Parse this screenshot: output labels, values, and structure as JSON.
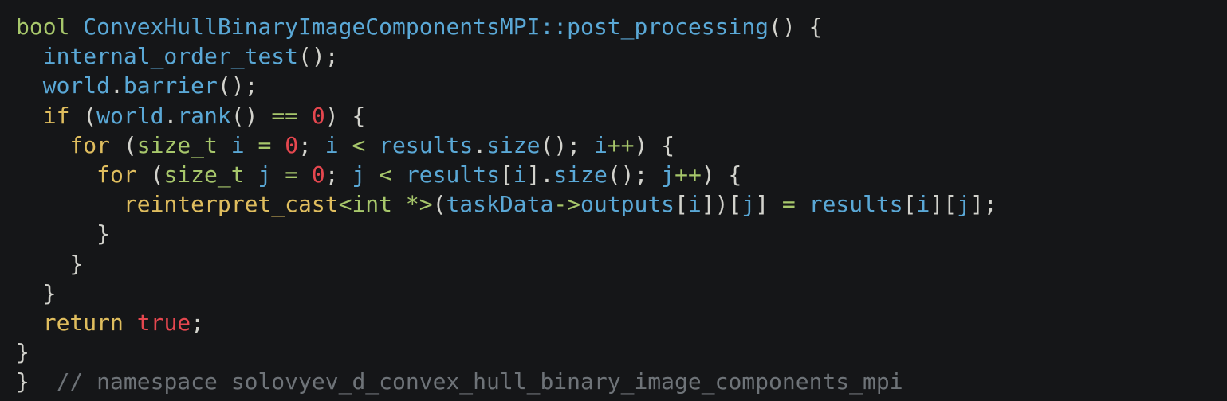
{
  "lines": [
    [
      {
        "t": "bool",
        "c": "type"
      },
      {
        "t": " ",
        "c": "plain"
      },
      {
        "t": "ConvexHullBinaryImageComponentsMPI",
        "c": "fn"
      },
      {
        "t": "::",
        "c": "fn"
      },
      {
        "t": "post_processing",
        "c": "fn"
      },
      {
        "t": "() {",
        "c": "plain"
      }
    ],
    [
      {
        "t": "  ",
        "c": "plain"
      },
      {
        "t": "internal_order_test",
        "c": "fn"
      },
      {
        "t": "();",
        "c": "plain"
      }
    ],
    [
      {
        "t": "  ",
        "c": "plain"
      },
      {
        "t": "world",
        "c": "fn"
      },
      {
        "t": ".",
        "c": "plain"
      },
      {
        "t": "barrier",
        "c": "fn"
      },
      {
        "t": "();",
        "c": "plain"
      }
    ],
    [
      {
        "t": "  ",
        "c": "plain"
      },
      {
        "t": "if",
        "c": "kw"
      },
      {
        "t": " (",
        "c": "plain"
      },
      {
        "t": "world",
        "c": "fn"
      },
      {
        "t": ".",
        "c": "plain"
      },
      {
        "t": "rank",
        "c": "fn"
      },
      {
        "t": "() ",
        "c": "plain"
      },
      {
        "t": "==",
        "c": "op"
      },
      {
        "t": " ",
        "c": "plain"
      },
      {
        "t": "0",
        "c": "num"
      },
      {
        "t": ") {",
        "c": "plain"
      }
    ],
    [
      {
        "t": "    ",
        "c": "plain"
      },
      {
        "t": "for",
        "c": "kw"
      },
      {
        "t": " (",
        "c": "plain"
      },
      {
        "t": "size_t",
        "c": "type"
      },
      {
        "t": " ",
        "c": "plain"
      },
      {
        "t": "i",
        "c": "fn"
      },
      {
        "t": " ",
        "c": "plain"
      },
      {
        "t": "=",
        "c": "op"
      },
      {
        "t": " ",
        "c": "plain"
      },
      {
        "t": "0",
        "c": "num"
      },
      {
        "t": "; ",
        "c": "plain"
      },
      {
        "t": "i",
        "c": "fn"
      },
      {
        "t": " ",
        "c": "plain"
      },
      {
        "t": "<",
        "c": "op"
      },
      {
        "t": " ",
        "c": "plain"
      },
      {
        "t": "results",
        "c": "fn"
      },
      {
        "t": ".",
        "c": "plain"
      },
      {
        "t": "size",
        "c": "fn"
      },
      {
        "t": "(); ",
        "c": "plain"
      },
      {
        "t": "i",
        "c": "fn"
      },
      {
        "t": "++",
        "c": "op"
      },
      {
        "t": ") {",
        "c": "plain"
      }
    ],
    [
      {
        "t": "      ",
        "c": "plain"
      },
      {
        "t": "for",
        "c": "kw"
      },
      {
        "t": " (",
        "c": "plain"
      },
      {
        "t": "size_t",
        "c": "type"
      },
      {
        "t": " ",
        "c": "plain"
      },
      {
        "t": "j",
        "c": "fn"
      },
      {
        "t": " ",
        "c": "plain"
      },
      {
        "t": "=",
        "c": "op"
      },
      {
        "t": " ",
        "c": "plain"
      },
      {
        "t": "0",
        "c": "num"
      },
      {
        "t": "; ",
        "c": "plain"
      },
      {
        "t": "j",
        "c": "fn"
      },
      {
        "t": " ",
        "c": "plain"
      },
      {
        "t": "<",
        "c": "op"
      },
      {
        "t": " ",
        "c": "plain"
      },
      {
        "t": "results",
        "c": "fn"
      },
      {
        "t": "[",
        "c": "plain"
      },
      {
        "t": "i",
        "c": "fn"
      },
      {
        "t": "].",
        "c": "plain"
      },
      {
        "t": "size",
        "c": "fn"
      },
      {
        "t": "(); ",
        "c": "plain"
      },
      {
        "t": "j",
        "c": "fn"
      },
      {
        "t": "++",
        "c": "op"
      },
      {
        "t": ") {",
        "c": "plain"
      }
    ],
    [
      {
        "t": "        ",
        "c": "plain"
      },
      {
        "t": "reinterpret_cast",
        "c": "kw"
      },
      {
        "t": "<",
        "c": "op"
      },
      {
        "t": "int",
        "c": "type"
      },
      {
        "t": " ",
        "c": "plain"
      },
      {
        "t": "*>",
        "c": "op"
      },
      {
        "t": "(",
        "c": "plain"
      },
      {
        "t": "taskData",
        "c": "fn"
      },
      {
        "t": "->",
        "c": "op"
      },
      {
        "t": "outputs",
        "c": "fn"
      },
      {
        "t": "[",
        "c": "plain"
      },
      {
        "t": "i",
        "c": "fn"
      },
      {
        "t": "])[",
        "c": "plain"
      },
      {
        "t": "j",
        "c": "fn"
      },
      {
        "t": "] ",
        "c": "plain"
      },
      {
        "t": "=",
        "c": "op"
      },
      {
        "t": " ",
        "c": "plain"
      },
      {
        "t": "results",
        "c": "fn"
      },
      {
        "t": "[",
        "c": "plain"
      },
      {
        "t": "i",
        "c": "fn"
      },
      {
        "t": "][",
        "c": "plain"
      },
      {
        "t": "j",
        "c": "fn"
      },
      {
        "t": "];",
        "c": "plain"
      }
    ],
    [
      {
        "t": "      }",
        "c": "plain"
      }
    ],
    [
      {
        "t": "    }",
        "c": "plain"
      }
    ],
    [
      {
        "t": "  }",
        "c": "plain"
      }
    ],
    [
      {
        "t": "  ",
        "c": "plain"
      },
      {
        "t": "return",
        "c": "kw"
      },
      {
        "t": " ",
        "c": "plain"
      },
      {
        "t": "true",
        "c": "num"
      },
      {
        "t": ";",
        "c": "plain"
      }
    ],
    [
      {
        "t": "}",
        "c": "plain"
      }
    ],
    [
      {
        "t": "}  ",
        "c": "plain"
      },
      {
        "t": "// namespace solovyev_d_convex_hull_binary_image_components_mpi",
        "c": "comment"
      }
    ]
  ]
}
